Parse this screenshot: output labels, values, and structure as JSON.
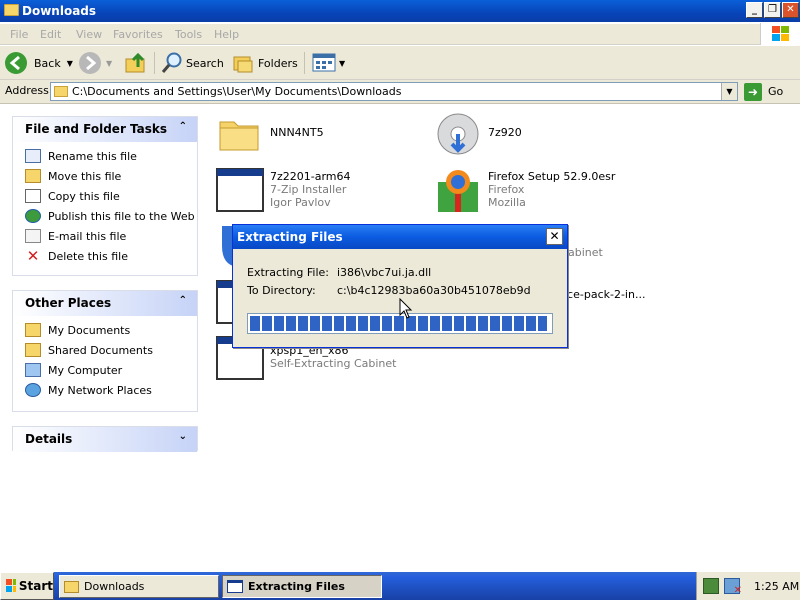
{
  "window": {
    "title": "Downloads"
  },
  "menu": [
    "File",
    "Edit",
    "View",
    "Favorites",
    "Tools",
    "Help"
  ],
  "toolbar": {
    "back": "Back",
    "search": "Search",
    "folders": "Folders"
  },
  "address": {
    "label": "Address",
    "path": "C:\\Documents and Settings\\User\\My Documents\\Downloads",
    "go": "Go"
  },
  "tasks_panel": {
    "title": "File and Folder Tasks",
    "items": [
      "Rename this file",
      "Move this file",
      "Copy this file",
      "Publish this file to the Web",
      "E-mail this file",
      "Delete this file"
    ]
  },
  "places_panel": {
    "title": "Other Places",
    "items": [
      "My Documents",
      "Shared Documents",
      "My Computer",
      "My Network Places"
    ]
  },
  "details_panel": {
    "title": "Details"
  },
  "files": [
    {
      "name": "NNN4NT5",
      "line2": "",
      "line3": "",
      "icon": "folder-icon"
    },
    {
      "name": "7z920",
      "line2": "",
      "line3": "",
      "icon": "installer-disc-icon"
    },
    {
      "name": "7z2201-arm64",
      "line2": "7-Zip Installer",
      "line3": "Igor Pavlov",
      "icon": "exe-window-icon"
    },
    {
      "name": "Firefox Setup 52.9.0esr",
      "line2": "Firefox",
      "line3": "Mozilla",
      "icon": "firefox-setup-icon"
    },
    {
      "name": "abinet",
      "icon": "cab-icon"
    },
    {
      "name": "ice-pack-2-in...",
      "icon": "exe-window-icon"
    },
    {
      "name": "xpsp1_en_x86",
      "line2": "Self-Extracting Cabinet",
      "icon": "exe-window-icon"
    }
  ],
  "dialog": {
    "title": "Extracting Files",
    "file_label": "Extracting File:",
    "file_value": "i386\\vbc7ui.ja.dll",
    "dir_label": "To Directory:",
    "dir_value": "c:\\b4c12983ba60a30b451078eb9d",
    "progress": 0.99
  },
  "taskbar": {
    "start": "Start",
    "task1": "Downloads",
    "task2": "Extracting Files",
    "clock": "1:25 AM"
  }
}
